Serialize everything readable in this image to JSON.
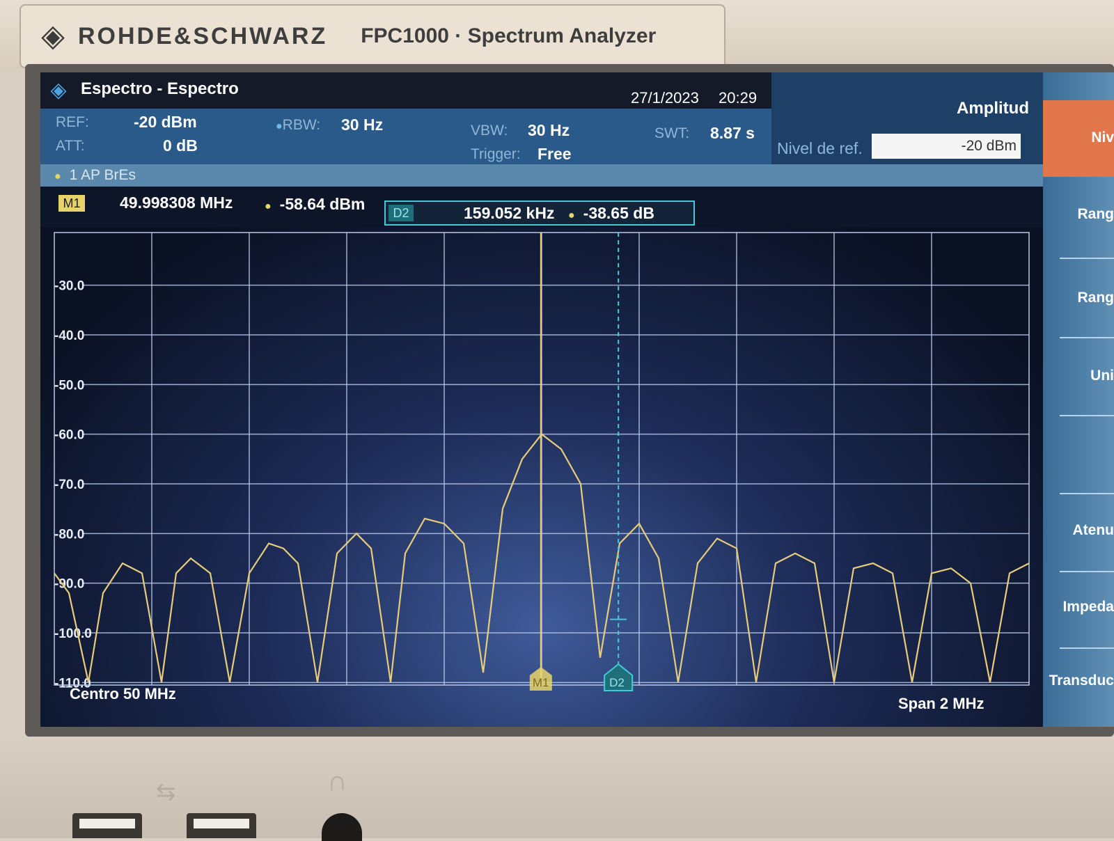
{
  "device": {
    "brand": "ROHDE&SCHWARZ",
    "model": "FPC1000 · Spectrum Analyzer"
  },
  "header": {
    "title": "Espectro - Espectro",
    "date": "27/1/2023",
    "time": "20:29"
  },
  "params": {
    "ref_label": "REF:",
    "ref_value": "-20 dBm",
    "att_label": "ATT:",
    "att_value": "0 dB",
    "rbw_label": "RBW:",
    "rbw_value": "30 Hz",
    "vbw_label": "VBW:",
    "vbw_value": "30 Hz",
    "trigger_label": "Trigger:",
    "trigger_value": "Free",
    "swt_label": "SWT:",
    "swt_value": "8.87 s"
  },
  "trace": {
    "label": "1 AP BrEs"
  },
  "markers": {
    "m1": {
      "badge": "M1",
      "freq": "49.998308 MHz",
      "amp": "-58.64 dBm"
    },
    "d2": {
      "badge": "D2",
      "freq": "159.052 kHz",
      "amp": "-38.65 dB"
    }
  },
  "panel": {
    "title": "Amplitud",
    "ref_label": "Nivel de ref.",
    "ref_input": "-20 dBm"
  },
  "softkeys": [
    "Niv",
    "Rang",
    "Rang",
    "Uni",
    "Atenu",
    "Impeda",
    "Transduc"
  ],
  "footer": {
    "center": "Centro 50 MHz",
    "span": "Span 2 MHz"
  },
  "colors": {
    "trace": "#e8cc7a",
    "m1": "#e6d46a",
    "d2": "#46c9d4",
    "grid": "#b9c8ea"
  },
  "chart_data": {
    "type": "line",
    "x_unit": "MHz",
    "y_unit": "dBm",
    "xlim": [
      49.0,
      51.0
    ],
    "ylim": [
      -120,
      -20
    ],
    "grid": true,
    "ytick_labels": [
      "-30.0",
      "-40.0",
      "-50.0",
      "-60.0",
      "-70.0",
      "-80.0",
      "-90.0",
      "-100.0",
      "-110.0"
    ],
    "ytick_values": [
      -30,
      -40,
      -50,
      -60,
      -70,
      -80,
      -90,
      -100,
      -110
    ],
    "x_gridlines": [
      49.2,
      49.4,
      49.6,
      49.8,
      50.0,
      50.2,
      50.4,
      50.6,
      50.8
    ],
    "series": [
      {
        "x": [
          49.0,
          49.03,
          49.07,
          49.1,
          49.14,
          49.18,
          49.22,
          49.25,
          49.28,
          49.32,
          49.36,
          49.4,
          49.44,
          49.47,
          49.5,
          49.54,
          49.58,
          49.62,
          49.65,
          49.69,
          49.72,
          49.76,
          49.8,
          49.84,
          49.88,
          49.92,
          49.96,
          50.0,
          50.04,
          50.08,
          50.12,
          50.16,
          50.2,
          50.24,
          50.28,
          50.32,
          50.36,
          50.4,
          50.44,
          50.48,
          50.52,
          50.56,
          50.6,
          50.64,
          50.68,
          50.72,
          50.76,
          50.8,
          50.84,
          50.88,
          50.92,
          50.96,
          51.0
        ],
        "y": [
          -88,
          -92,
          -112,
          -92,
          -86,
          -88,
          -114,
          -88,
          -85,
          -88,
          -114,
          -88,
          -82,
          -83,
          -86,
          -112,
          -84,
          -80,
          -83,
          -110,
          -84,
          -77,
          -78,
          -82,
          -108,
          -75,
          -65,
          -60,
          -63,
          -70,
          -105,
          -82,
          -78,
          -85,
          -110,
          -86,
          -81,
          -83,
          -112,
          -86,
          -84,
          -86,
          -113,
          -87,
          -86,
          -88,
          -113,
          -88,
          -87,
          -90,
          -114,
          -88,
          -86
        ]
      }
    ],
    "markers": [
      {
        "name": "M1",
        "x": 49.998308,
        "y": -58.64
      },
      {
        "name": "D2",
        "x": 50.15736,
        "y": -97.29,
        "delta_freq": "159.052 kHz",
        "delta_level": "-38.65 dB"
      }
    ]
  }
}
